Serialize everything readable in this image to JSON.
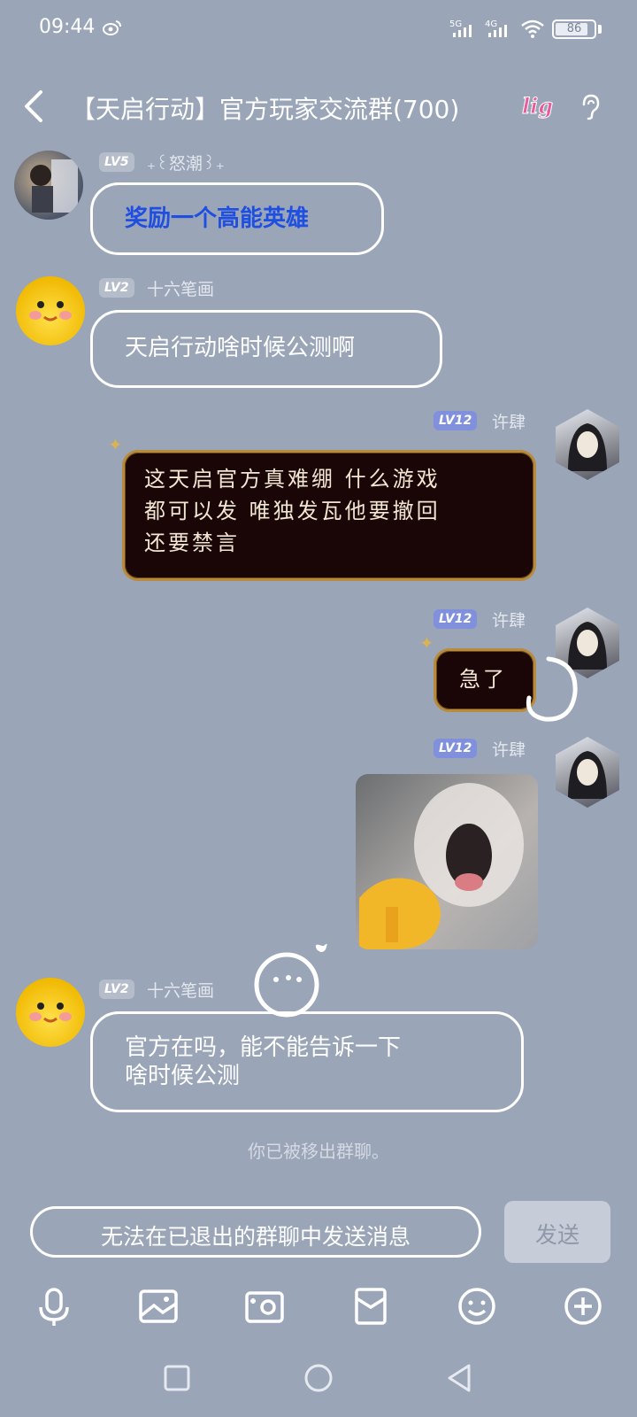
{
  "status_bar": {
    "time": "09:44",
    "signal_1": "5G",
    "signal_2": "4G",
    "battery": "86",
    "battery_level_percent": 86
  },
  "header": {
    "title": "【天启行动】官方玩家交流群(700)",
    "sticker": "lig"
  },
  "messages": [
    {
      "level": "LV5",
      "nickname": "₊꒰怒潮꒱₊",
      "text": "奖励一个高能英雄",
      "side": "left"
    },
    {
      "level": "LV2",
      "nickname": "十六笔画",
      "text": "天启行动啥时候公测啊",
      "side": "left"
    },
    {
      "level": "LV12",
      "nickname": "许肆",
      "lines": [
        "这天启官方真难绷 什么游戏",
        "都可以发 唯独发瓦他要撤回",
        "还要禁言"
      ],
      "side": "right"
    },
    {
      "level": "LV12",
      "nickname": "许肆",
      "text": "急了",
      "side": "right"
    },
    {
      "level": "LV12",
      "nickname": "许肆",
      "type": "image",
      "side": "right"
    },
    {
      "level": "LV2",
      "nickname": "十六笔画",
      "lines": [
        "官方在吗，能不能告诉一下",
        "啥时候公测"
      ],
      "side": "left"
    }
  ],
  "system_note": "你已被移出群聊。",
  "input": {
    "placeholder": "无法在已退出的群聊中发送消息",
    "send_label": "发送"
  },
  "toolbar": {
    "icons": [
      "microphone-icon",
      "image-icon",
      "camera-icon",
      "red-packet-icon",
      "emoji-icon",
      "plus-icon"
    ]
  },
  "nav": {
    "icons": [
      "recents-icon",
      "home-icon",
      "back-icon"
    ]
  },
  "colors": {
    "background": "#9aa5b8",
    "bubble_dark": "#1a0607",
    "bubble_gold_border": "#b88a3c",
    "lv_blue": "#8090dd",
    "highlight_text": "#1f4fe0"
  }
}
